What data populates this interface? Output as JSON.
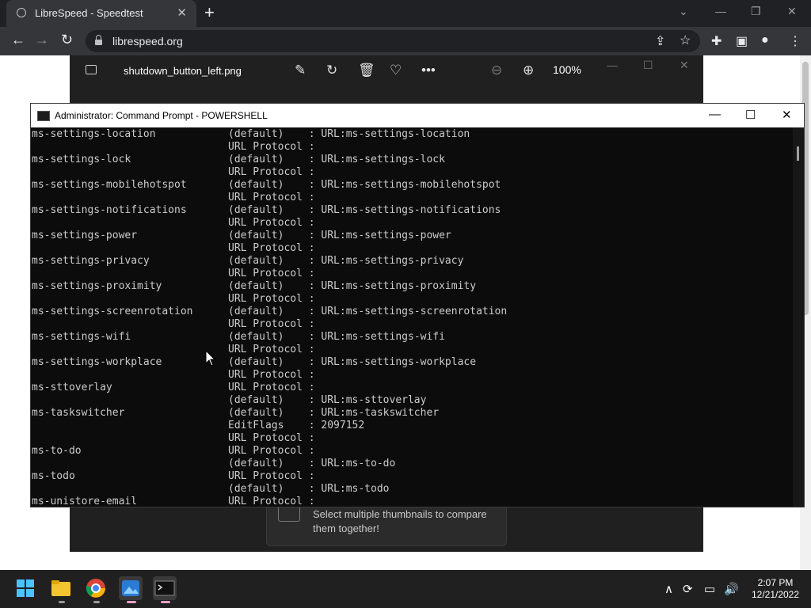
{
  "browser": {
    "tab_title": "LibreSpeed - Speedtest",
    "tab_close": "✕",
    "new_tab": "+",
    "url": "librespeed.org",
    "window_controls": [
      "⌄",
      "—",
      "❐",
      "✕"
    ]
  },
  "photos": {
    "file_name": "shutdown_button_left.png",
    "zoom": "100%",
    "hint": "Select multiple thumbnails to compare them together!"
  },
  "console": {
    "title": "Administrator: Command Prompt - POWERSHELL",
    "lines": [
      [
        "ms-settings-location",
        "(default)    : URL:ms-settings-location"
      ],
      [
        "",
        "URL Protocol :"
      ],
      [
        "ms-settings-lock",
        "(default)    : URL:ms-settings-lock"
      ],
      [
        "",
        "URL Protocol :"
      ],
      [
        "ms-settings-mobilehotspot",
        "(default)    : URL:ms-settings-mobilehotspot"
      ],
      [
        "",
        "URL Protocol :"
      ],
      [
        "ms-settings-notifications",
        "(default)    : URL:ms-settings-notifications"
      ],
      [
        "",
        "URL Protocol :"
      ],
      [
        "ms-settings-power",
        "(default)    : URL:ms-settings-power"
      ],
      [
        "",
        "URL Protocol :"
      ],
      [
        "ms-settings-privacy",
        "(default)    : URL:ms-settings-privacy"
      ],
      [
        "",
        "URL Protocol :"
      ],
      [
        "ms-settings-proximity",
        "(default)    : URL:ms-settings-proximity"
      ],
      [
        "",
        "URL Protocol :"
      ],
      [
        "ms-settings-screenrotation",
        "(default)    : URL:ms-settings-screenrotation"
      ],
      [
        "",
        "URL Protocol :"
      ],
      [
        "ms-settings-wifi",
        "(default)    : URL:ms-settings-wifi"
      ],
      [
        "",
        "URL Protocol :"
      ],
      [
        "ms-settings-workplace",
        "(default)    : URL:ms-settings-workplace"
      ],
      [
        "",
        "URL Protocol :"
      ],
      [
        "ms-sttoverlay",
        "URL Protocol :"
      ],
      [
        "",
        "(default)    : URL:ms-sttoverlay"
      ],
      [
        "ms-taskswitcher",
        "(default)    : URL:ms-taskswitcher"
      ],
      [
        "",
        "EditFlags    : 2097152"
      ],
      [
        "",
        "URL Protocol :"
      ],
      [
        "ms-to-do",
        "URL Protocol :"
      ],
      [
        "",
        "(default)    : URL:ms-to-do"
      ],
      [
        "ms-todo",
        "URL Protocol :"
      ],
      [
        "",
        "(default)    : URL:ms-todo"
      ],
      [
        "ms-unistore-email",
        "URL Protocol :"
      ]
    ]
  },
  "taskbar": {
    "time": "2:07 PM",
    "date": "12/21/2022"
  }
}
